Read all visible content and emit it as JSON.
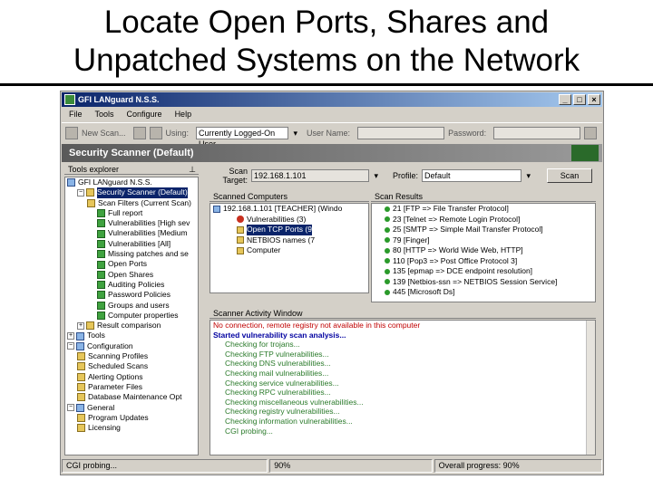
{
  "slide": {
    "title_line1": "Locate Open Ports, Shares and",
    "title_line2": "Unpatched Systems on the Network"
  },
  "window": {
    "title": "GFI LANguard N.S.S.",
    "menu": [
      "File",
      "Tools",
      "Configure",
      "Help"
    ],
    "toolbar": {
      "new_scan": "New Scan...",
      "using_label": "Using:",
      "using_value": "Currently Logged-On User",
      "username_label": "User Name:",
      "password_label": "Password:"
    },
    "banner": "Security Scanner (Default)"
  },
  "tools_explorer": {
    "header": "Tools explorer",
    "items": [
      {
        "label": "GFI LANguard N.S.S.",
        "icon": "app-icon",
        "indent": 0
      },
      {
        "label": "Security Scanner (Default)",
        "icon": "scanner-icon",
        "indent": 1,
        "selected": true
      },
      {
        "label": "Scan Filters (Current Scan)",
        "icon": "filter-icon",
        "indent": 2
      },
      {
        "label": "Full report",
        "icon": "check-icon",
        "indent": 3
      },
      {
        "label": "Vulnerabilities [High sev",
        "icon": "check-icon",
        "indent": 3
      },
      {
        "label": "Vulnerabilities [Medium",
        "icon": "check-icon",
        "indent": 3
      },
      {
        "label": "Vulnerabilities [All]",
        "icon": "check-icon",
        "indent": 3
      },
      {
        "label": "Missing patches and se",
        "icon": "check-icon",
        "indent": 3
      },
      {
        "label": "Open Ports",
        "icon": "check-icon",
        "indent": 3
      },
      {
        "label": "Open Shares",
        "icon": "check-icon",
        "indent": 3
      },
      {
        "label": "Auditing Policies",
        "icon": "check-icon",
        "indent": 3
      },
      {
        "label": "Password Policies",
        "icon": "check-icon",
        "indent": 3
      },
      {
        "label": "Groups and users",
        "icon": "check-icon",
        "indent": 3
      },
      {
        "label": "Computer properties",
        "icon": "check-icon",
        "indent": 3
      },
      {
        "label": "Result comparison",
        "icon": "compare-icon",
        "indent": 1
      },
      {
        "label": "Tools",
        "icon": "tools-icon",
        "indent": 0
      },
      {
        "label": "Configuration",
        "icon": "config-icon",
        "indent": 0
      },
      {
        "label": "Scanning Profiles",
        "icon": "profile-icon",
        "indent": 1
      },
      {
        "label": "Scheduled Scans",
        "icon": "schedule-icon",
        "indent": 1
      },
      {
        "label": "Alerting Options",
        "icon": "alert-icon",
        "indent": 1
      },
      {
        "label": "Parameter Files",
        "icon": "file-icon",
        "indent": 1
      },
      {
        "label": "Database Maintenance Opt",
        "icon": "db-icon",
        "indent": 1
      },
      {
        "label": "General",
        "icon": "general-icon",
        "indent": 0
      },
      {
        "label": "Program Updates",
        "icon": "update-icon",
        "indent": 1
      },
      {
        "label": "Licensing",
        "icon": "license-icon",
        "indent": 1
      }
    ]
  },
  "scan_target": {
    "label": "Scan Target:",
    "value": "192.168.1.101",
    "profile_label": "Profile:",
    "profile_value": "Default",
    "scan_button": "Scan"
  },
  "scanned_computers": {
    "header": "Scanned Computers",
    "items": [
      {
        "label": "192.168.1.101 [TEACHER] (Windo",
        "indent": 0
      },
      {
        "label": "Vulnerabilities (3)",
        "indent": 1
      },
      {
        "label": "Open TCP Ports (9",
        "indent": 1,
        "selected": true
      },
      {
        "label": "NETBIOS names (7",
        "indent": 1
      },
      {
        "label": "Computer",
        "indent": 1
      }
    ]
  },
  "scan_results": {
    "header": "Scan Results",
    "items": [
      "21 [FTP => File Transfer Protocol]",
      "23 [Telnet => Remote Login Protocol]",
      "25 [SMTP => Simple Mail Transfer Protocol]",
      "79 [Finger]",
      "80 [HTTP => World Wide Web, HTTP]",
      "110 [Pop3 => Post Office Protocol 3]",
      "135 [epmap => DCE endpoint resolution]",
      "139 [Netbios-ssn => NETBIOS Session Service]",
      "445 [Microsoft Ds]"
    ]
  },
  "activity": {
    "header": "Scanner Activity Window",
    "lines": [
      {
        "text": "No connection, remote registry not available in this computer",
        "kind": "err"
      },
      {
        "text": "Started vulnerability scan analysis...",
        "kind": "info"
      },
      {
        "text": "Checking for trojans...",
        "kind": "step"
      },
      {
        "text": "Checking FTP vulnerabilities...",
        "kind": "step"
      },
      {
        "text": "Checking DNS vulnerabilities...",
        "kind": "step"
      },
      {
        "text": "Checking mail vulnerabilities...",
        "kind": "step"
      },
      {
        "text": "Checking service vulnerabilities...",
        "kind": "step"
      },
      {
        "text": "Checking RPC vulnerabilities...",
        "kind": "step"
      },
      {
        "text": "Checking miscellaneous vulnerabilities...",
        "kind": "step"
      },
      {
        "text": "Checking registry vulnerabilities...",
        "kind": "step"
      },
      {
        "text": "Checking information vulnerabilities...",
        "kind": "step"
      },
      {
        "text": "CGI probing...",
        "kind": "step"
      }
    ]
  },
  "statusbar": {
    "left": "CGI probing...",
    "middle": "90%",
    "right": "Overall progress: 90%"
  }
}
